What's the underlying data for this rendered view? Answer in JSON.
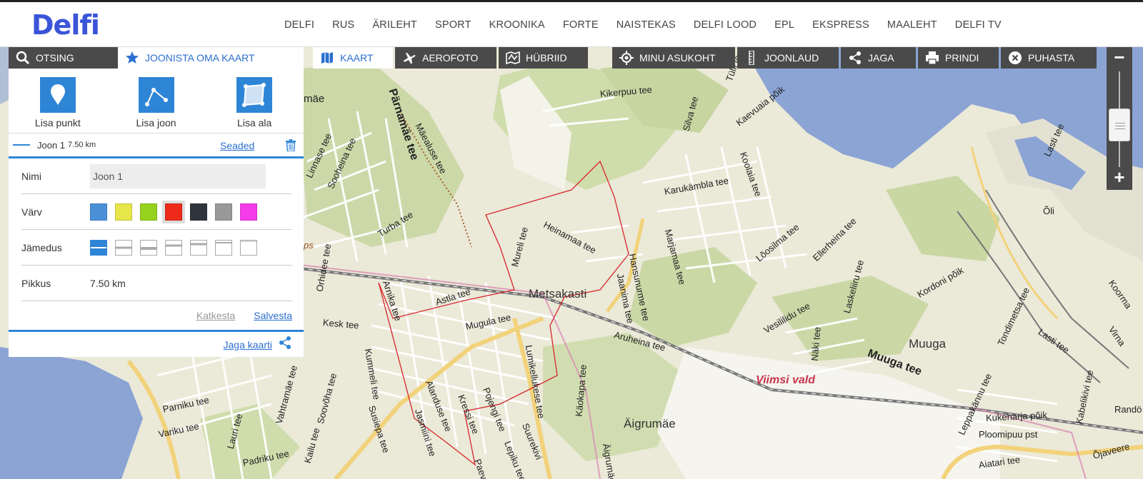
{
  "header": {
    "logo": "Delfi",
    "nav": [
      "DELFI",
      "RUS",
      "ÄRILEHT",
      "SPORT",
      "KROONIKA",
      "FORTE",
      "NAISTEKAS",
      "DELFI LOOD",
      "EPL",
      "EKSPRESS",
      "MAALEHT",
      "DELFI TV"
    ]
  },
  "panel": {
    "tab_search": "OTSING",
    "tab_draw": "JOONISTA OMA KAART",
    "tools": {
      "point": "Lisa punkt",
      "line": "Lisa joon",
      "area": "Lisa ala"
    },
    "line_item": {
      "name": "Joon 1",
      "length": "7.50 km",
      "settings": "Seaded"
    },
    "form": {
      "name_label": "Nimi",
      "name_value": "Joon 1",
      "color_label": "Värv",
      "colors": [
        "#4a90d9",
        "#e6e64a",
        "#96d21e",
        "#ee2a1a",
        "#2f353d",
        "#999999",
        "#f53ce9"
      ],
      "selected_color": "#ee2a1a",
      "thickness_label": "Jämedus",
      "length_label": "Pikkus",
      "length_value": "7.50 km"
    },
    "cancel": "Katkesta",
    "save": "Salvesta",
    "share": "Jaga kaarti"
  },
  "toolbar": {
    "kaart": "KAART",
    "aerofoto": "AEROFOTO",
    "hubriid": "HÜBRIID",
    "asukoht": "MINU ASUKOHT",
    "joonlaud": "JOONLAUD",
    "jaga": "JAGA",
    "prindi": "PRINDI",
    "puhasta": "PUHASTA"
  },
  "zoom": {
    "minus": "−",
    "plus": "+"
  },
  "map": {
    "streets": [
      "Pärnamäe tee",
      "Mäealuse tee",
      "Kikerpuu tee",
      "Tülli tee",
      "Kaevuaia põik",
      "Koolaia tee",
      "Silva tee",
      "Linnase tee",
      "Sooheina tee",
      "Turba tee",
      "Karukämbla tee",
      "Heinamaa tee",
      "Marjamaa tee",
      "Lõosilma tee",
      "Ellerheina tee",
      "Hansunurme tee",
      "Jaanima tee",
      "Orhidee tee",
      "Arnika tee",
      "Astla tee",
      "Mureli tee",
      "Aruheina tee",
      "Vesililidu tee",
      "Laskeliiru tee",
      "Kordoni põik",
      "Tondimetsa tee",
      "Lasti tee",
      "Kesk tee",
      "Kummeli tee",
      "Mugula tee",
      "Lumikellukese tee",
      "Muuga tee",
      "Näki tee",
      "Vahtramäe tee",
      "Soovõha tee",
      "Susiepa tee",
      "Alanduse tee",
      "Kressi tee",
      "Pojengi tee",
      "Käokapa tee",
      "Leppakännu tee",
      "Kukeharja põik",
      "Kabelikivi tee",
      "Parniku tee",
      "Variku tee",
      "Lauri tee",
      "Jasmiini tee",
      "Suurekivi",
      "Lepiku tee",
      "Ploomipuu pst",
      "Kailu tee",
      "Padriku tee",
      "Õli",
      "Lasti tee",
      "Koorma",
      "Virna",
      "Randö",
      "Õjaveere",
      "Aiatari tee",
      "Paeva",
      "Äigrumäe"
    ],
    "places": {
      "metsakasti": "Metsakasti",
      "muuga": "Muuga",
      "aigrumae": "Äigrumäe",
      "vald": "Viimsi vald",
      "mae": "mäe",
      "ps": "ps"
    }
  }
}
